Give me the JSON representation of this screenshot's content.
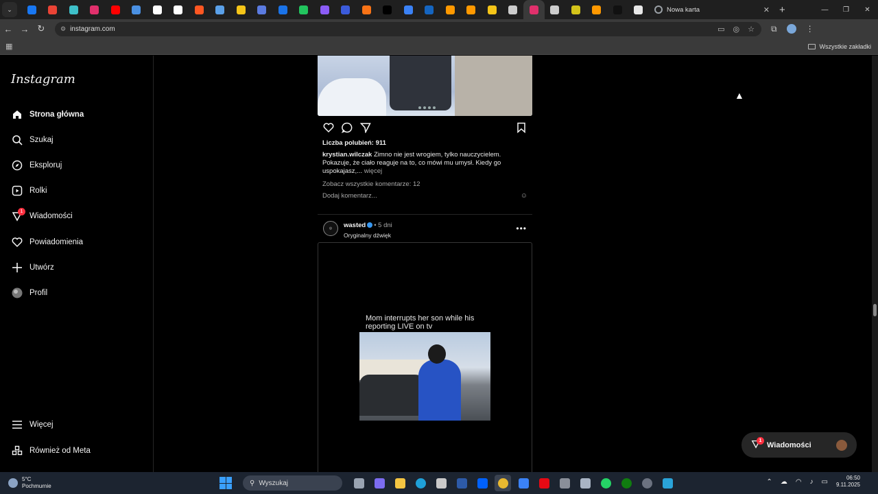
{
  "browser": {
    "active_tab_title": "Nowa karta",
    "url": "instagram.com",
    "bookmarks_all_label": "Wszystkie zakładki",
    "pinned_tab_colors": [
      "#1877f2",
      "#ea4335",
      "#3ec0c9",
      "#e1306c",
      "#ff0000",
      "#4a90e2",
      "#ffffff",
      "#ffffff",
      "#ff5722",
      "#5aa0e8",
      "#f5c518",
      "#5b7be0",
      "#1a73e8",
      "#22c55e",
      "#8b5cf6",
      "#3b5bdb",
      "#f97316",
      "#000000",
      "#3b82f6",
      "#1565c0",
      "#ff9900",
      "#ff9900",
      "#f5c518",
      "#cccccc",
      "#e1306c",
      "#cccccc",
      "#d4c41a",
      "#ff9900",
      "#111111",
      "#e8e8e8"
    ]
  },
  "sidebar": {
    "logo": "Instagram",
    "items": [
      {
        "label": "Strona główna",
        "icon": "home-icon"
      },
      {
        "label": "Szukaj",
        "icon": "search-icon"
      },
      {
        "label": "Eksploruj",
        "icon": "compass-icon"
      },
      {
        "label": "Rolki",
        "icon": "reels-icon"
      },
      {
        "label": "Wiadomości",
        "icon": "messenger-icon",
        "badge": "1"
      },
      {
        "label": "Powiadomienia",
        "icon": "heart-icon"
      },
      {
        "label": "Utwórz",
        "icon": "plus-icon"
      },
      {
        "label": "Profil",
        "icon": "avatar-icon"
      }
    ],
    "bottom_items": [
      {
        "label": "Więcej",
        "icon": "menu-icon"
      },
      {
        "label": "Również od Meta",
        "icon": "meta-icon"
      }
    ]
  },
  "post1": {
    "likes": "Liczba polubień: 911",
    "username": "krystian.wilczak",
    "caption": " Zimno nie jest wrogiem, tylko nauczycielem. Pokazuje, że ciało reaguje na to, co mówi mu umysł. Kiedy go uspokajasz,...",
    "more": " więcej",
    "view_comments": "Zobacz wszystkie komentarze: 12",
    "add_comment_placeholder": "Dodaj komentarz..."
  },
  "post2": {
    "username": "wasted",
    "time": "• 5 dni",
    "audio": "Oryginalny dźwięk",
    "video_text": "Mom interrupts her son while his reporting LIVE on tv"
  },
  "messages_pill": {
    "label": "Wiadomości",
    "badge": "1"
  },
  "taskbar": {
    "weather_temp": "5°C",
    "weather_desc": "Pochmurnie",
    "search_placeholder": "Wyszukaj",
    "time": "06:50",
    "date": "9.11.2025"
  }
}
